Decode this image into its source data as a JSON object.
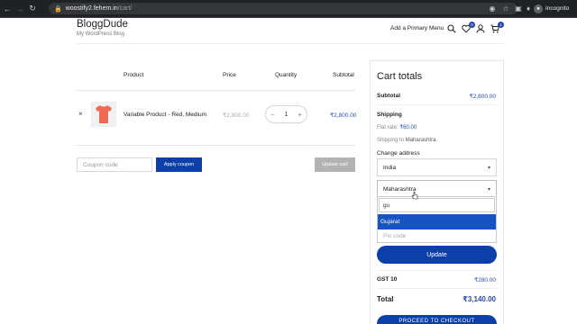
{
  "browser": {
    "url_host": "woostify2.fehem.in",
    "url_path": "/cart/",
    "profile_label": "Incognito"
  },
  "site": {
    "name": "BloggDude",
    "tagline": "My WordPress Blog",
    "menu_label": "Add a Primary Menu",
    "wishlist_count": "0",
    "cart_count": "1"
  },
  "cart": {
    "headers": {
      "product": "Product",
      "price": "Price",
      "quantity": "Quantity",
      "subtotal": "Subtotal"
    },
    "items": [
      {
        "remove": "×",
        "name": "Variable Product - Red, Medium",
        "price": "₹2,800.00",
        "quantity": "1",
        "subtotal": "₹2,800.00"
      }
    ],
    "coupon_placeholder": "Coupon code",
    "apply_coupon_label": "Apply coupon",
    "update_cart_label": "Update cart"
  },
  "totals": {
    "title": "Cart totals",
    "subtotal_label": "Subtotal",
    "subtotal_value": "₹2,800.00",
    "shipping_label": "Shipping",
    "flat_rate_label": "Flat rate: ",
    "flat_rate_value": "₹60.00",
    "shipping_to_prefix": "Shipping to ",
    "shipping_to_state": "Maharashtra",
    "shipping_to_suffix": ".",
    "change_address_label": "Change address",
    "country_value": "India",
    "state_value": "Maharashtra",
    "state_search_value": "gu",
    "state_highlighted_option": "Gujarat",
    "pin_placeholder": "Pin code",
    "update_label": "Update",
    "gst_label": "GST 10",
    "gst_value": "₹280.00",
    "total_label": "Total",
    "total_value": "₹3,140.00",
    "checkout_label": "PROCEED TO CHECKOUT"
  },
  "colors": {
    "accent": "#0d3fa8",
    "price_blue": "#2a4db2",
    "highlight": "#1554c2"
  }
}
